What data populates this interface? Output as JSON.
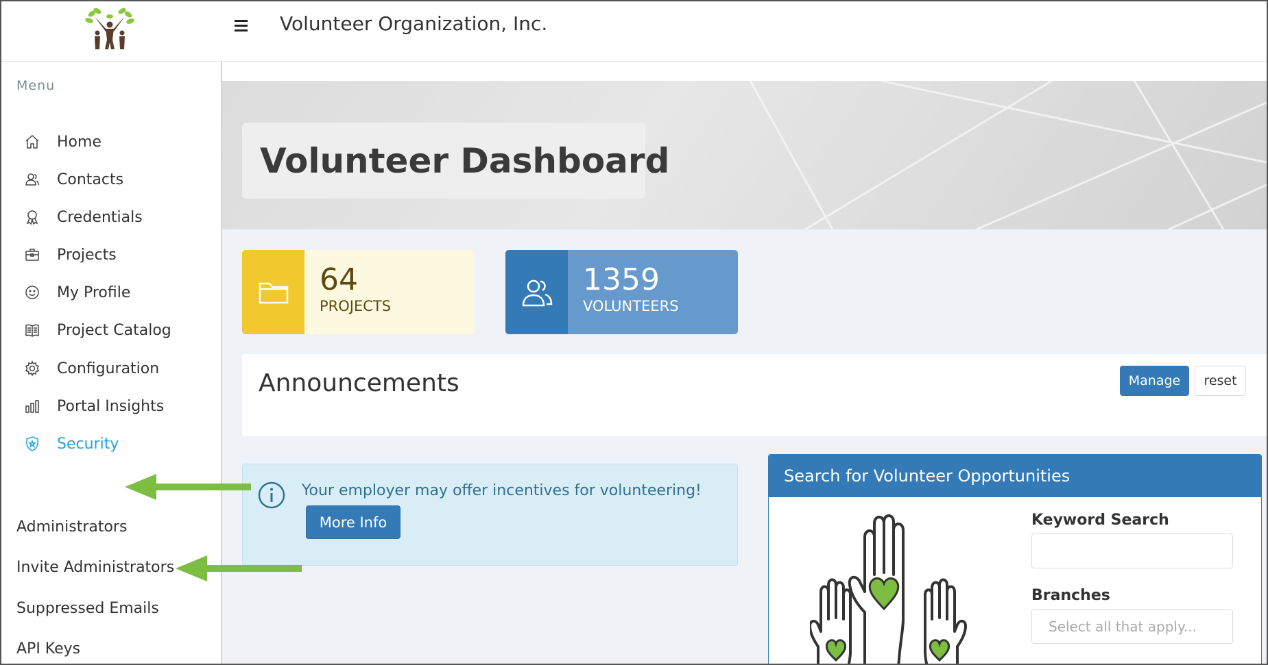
{
  "app": {
    "org_name": "Volunteer Organization, Inc."
  },
  "sidebar": {
    "caption": "Menu",
    "items": [
      {
        "label": "Home",
        "icon": "home-icon"
      },
      {
        "label": "Contacts",
        "icon": "contacts-icon"
      },
      {
        "label": "Credentials",
        "icon": "credentials-icon"
      },
      {
        "label": "Projects",
        "icon": "projects-icon"
      },
      {
        "label": "My Profile",
        "icon": "smiley-icon"
      },
      {
        "label": "Project Catalog",
        "icon": "catalog-icon"
      },
      {
        "label": "Configuration",
        "icon": "gear-icon"
      },
      {
        "label": "Portal Insights",
        "icon": "bar-chart-icon"
      },
      {
        "label": "Security",
        "icon": "shield-icon",
        "active": true
      }
    ],
    "sub_items": [
      "Administrators",
      "Invite Administrators",
      "Suppressed Emails",
      "API Keys"
    ]
  },
  "dashboard": {
    "title": "Volunteer Dashboard",
    "stats": {
      "projects": {
        "value": "64",
        "label": "PROJECTS"
      },
      "volunteers": {
        "value": "1359",
        "label": "VOLUNTEERS"
      }
    },
    "announcements": {
      "title": "Announcements",
      "manage_label": "Manage",
      "reset_label": "reset"
    },
    "info": {
      "text": "Your employer may offer incentives for volunteering!",
      "button_label": "More Info"
    },
    "search": {
      "title": "Search for Volunteer Opportunities",
      "keyword_label": "Keyword Search",
      "keyword_value": "",
      "branches_label": "Branches",
      "branches_placeholder": "Select all that apply..."
    }
  },
  "colors": {
    "accent": "#337ab7",
    "active_nav": "#1ea5de",
    "projects_icon_bg": "#f1c82e",
    "annotation_arrow": "#7cbd42"
  }
}
